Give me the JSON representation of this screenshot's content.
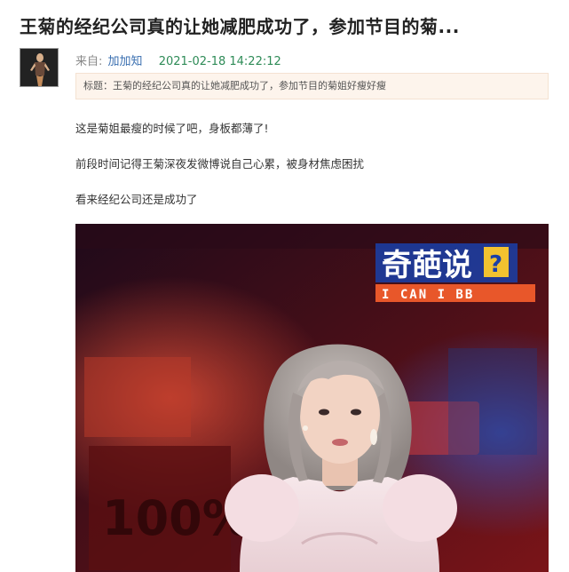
{
  "article": {
    "title": "王菊的经纪公司真的让她减肥成功了，参加节目的菊...",
    "meta": {
      "from_label": "来自:",
      "author": "加加知",
      "datetime": "2021-02-18 14:22:12"
    },
    "subtitle": "标题：王菊的经纪公司真的让她减肥成功了，参加节目的菊姐好瘦好瘦",
    "paragraphs": [
      "这是菊姐最瘦的时候了吧，身板都薄了!",
      "前段时间记得王菊深夜发微博说自己心累，被身材焦虑困扰",
      "看来经纪公司还是成功了"
    ]
  },
  "photo": {
    "logo_title": "奇葩说",
    "logo_badge": "?",
    "logo_subtitle": "I CAN I BB",
    "background_sign": "100%"
  }
}
